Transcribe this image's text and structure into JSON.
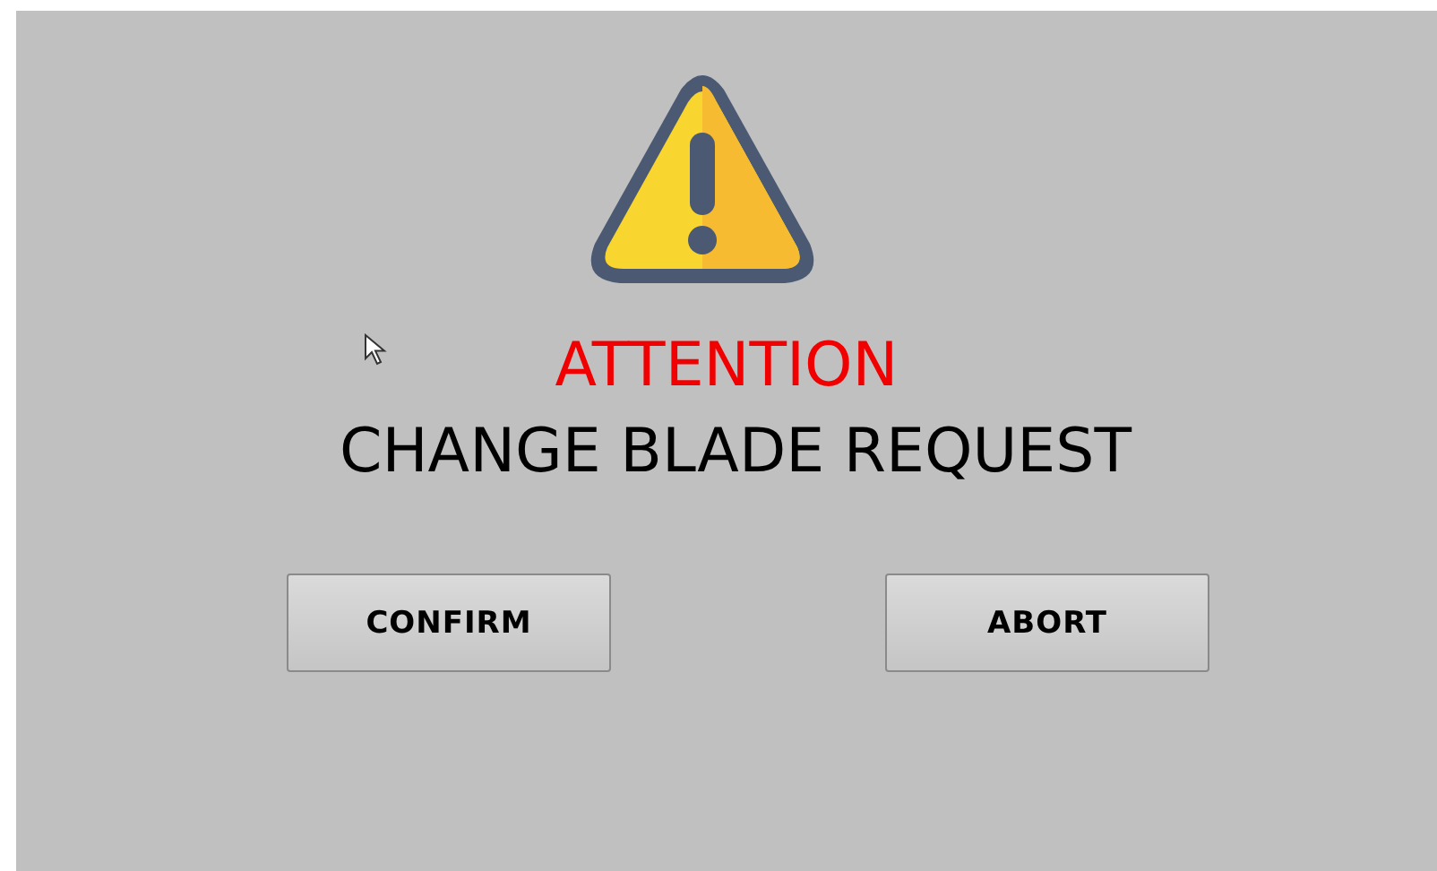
{
  "alert": {
    "title": "ATTENTION",
    "message": "CHANGE BLADE REQUEST"
  },
  "buttons": [
    {
      "label": "CONFIRM"
    },
    {
      "label": "ABORT"
    }
  ]
}
